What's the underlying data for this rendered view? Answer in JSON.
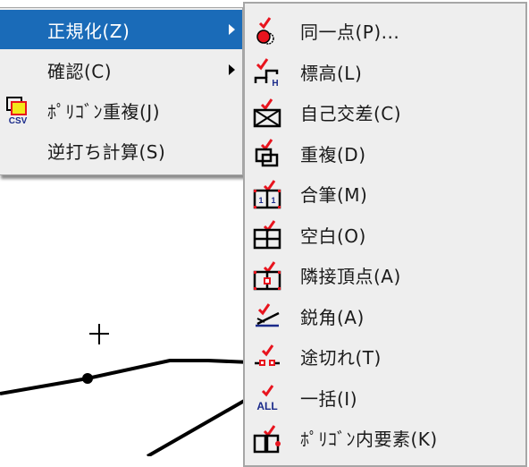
{
  "main_menu": {
    "items": [
      {
        "label": "正規化(Z)",
        "highlighted": true,
        "has_submenu": true,
        "icon": null
      },
      {
        "label": "確認(C)",
        "highlighted": false,
        "has_submenu": true,
        "icon": null
      },
      {
        "label": "ﾎﾟﾘｺﾞﾝ重複(J)",
        "highlighted": false,
        "has_submenu": false,
        "icon": "csv-polygon-overlap-icon"
      },
      {
        "label": "逆打ち計算(S)",
        "highlighted": false,
        "has_submenu": false,
        "icon": null
      }
    ]
  },
  "sub_menu": {
    "items": [
      {
        "label": "同一点(P)...",
        "icon": "same-point-icon"
      },
      {
        "label": "標高(L)",
        "icon": "elevation-icon"
      },
      {
        "label": "自己交差(C)",
        "icon": "self-intersection-icon"
      },
      {
        "label": "重複(D)",
        "icon": "duplicate-icon"
      },
      {
        "label": "合筆(M)",
        "icon": "merge-parcel-icon"
      },
      {
        "label": "空白(O)",
        "icon": "blank-icon"
      },
      {
        "label": "隣接頂点(A)",
        "icon": "adjacent-vertex-icon"
      },
      {
        "label": "鋭角(A)",
        "icon": "acute-angle-icon"
      },
      {
        "label": "途切れ(T)",
        "icon": "gap-icon"
      },
      {
        "label": "一括(I)",
        "icon": "all-icon"
      },
      {
        "label": "ﾎﾟﾘｺﾞﾝ内要素(K)",
        "icon": "polygon-inner-element-icon"
      }
    ]
  },
  "colors": {
    "highlight": "#1a6bb8",
    "menu_bg": "#eeeeee",
    "check_red": "#e8141e",
    "icon_blue": "#1a2a8a"
  },
  "icons": {
    "all_text": "ALL",
    "csv_text": "CSV"
  }
}
